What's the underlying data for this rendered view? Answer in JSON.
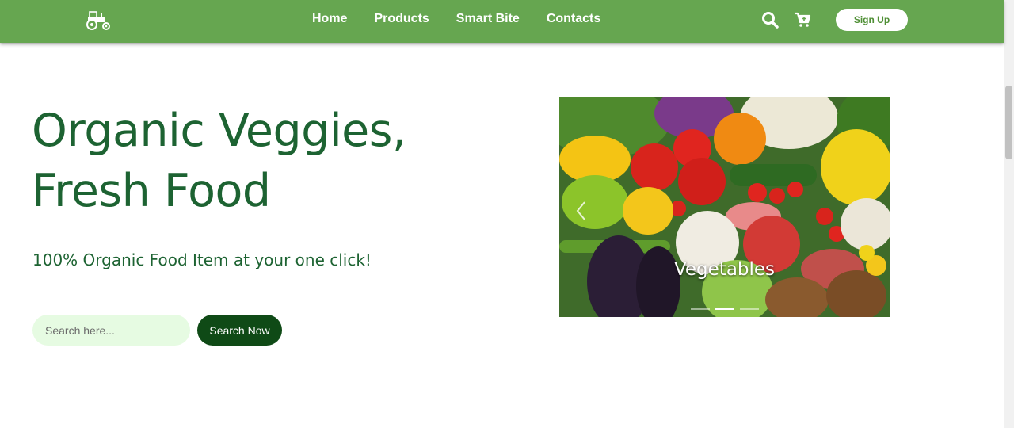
{
  "navbar": {
    "logo_icon": "tractor-icon",
    "links": [
      "Home",
      "Products",
      "Smart Bite",
      "Contacts"
    ],
    "search_icon": "search-icon",
    "cart_icon": "cart-plus-icon",
    "signup_label": "Sign Up"
  },
  "hero": {
    "title_line1": "Organic Veggies,",
    "title_line2": "Fresh Food",
    "subtitle": "100% Organic Food Item at your one click!",
    "search_placeholder": "Search here...",
    "search_button": "Search Now"
  },
  "carousel": {
    "caption": "Vegetables",
    "prev_icon": "chevron-left-icon",
    "slide_count": 3,
    "active_slide": 2
  },
  "colors": {
    "nav_bg": "#66a650",
    "title": "#1d6332",
    "search_bg": "#e6fbe2",
    "button_bg": "#0f4a16"
  }
}
